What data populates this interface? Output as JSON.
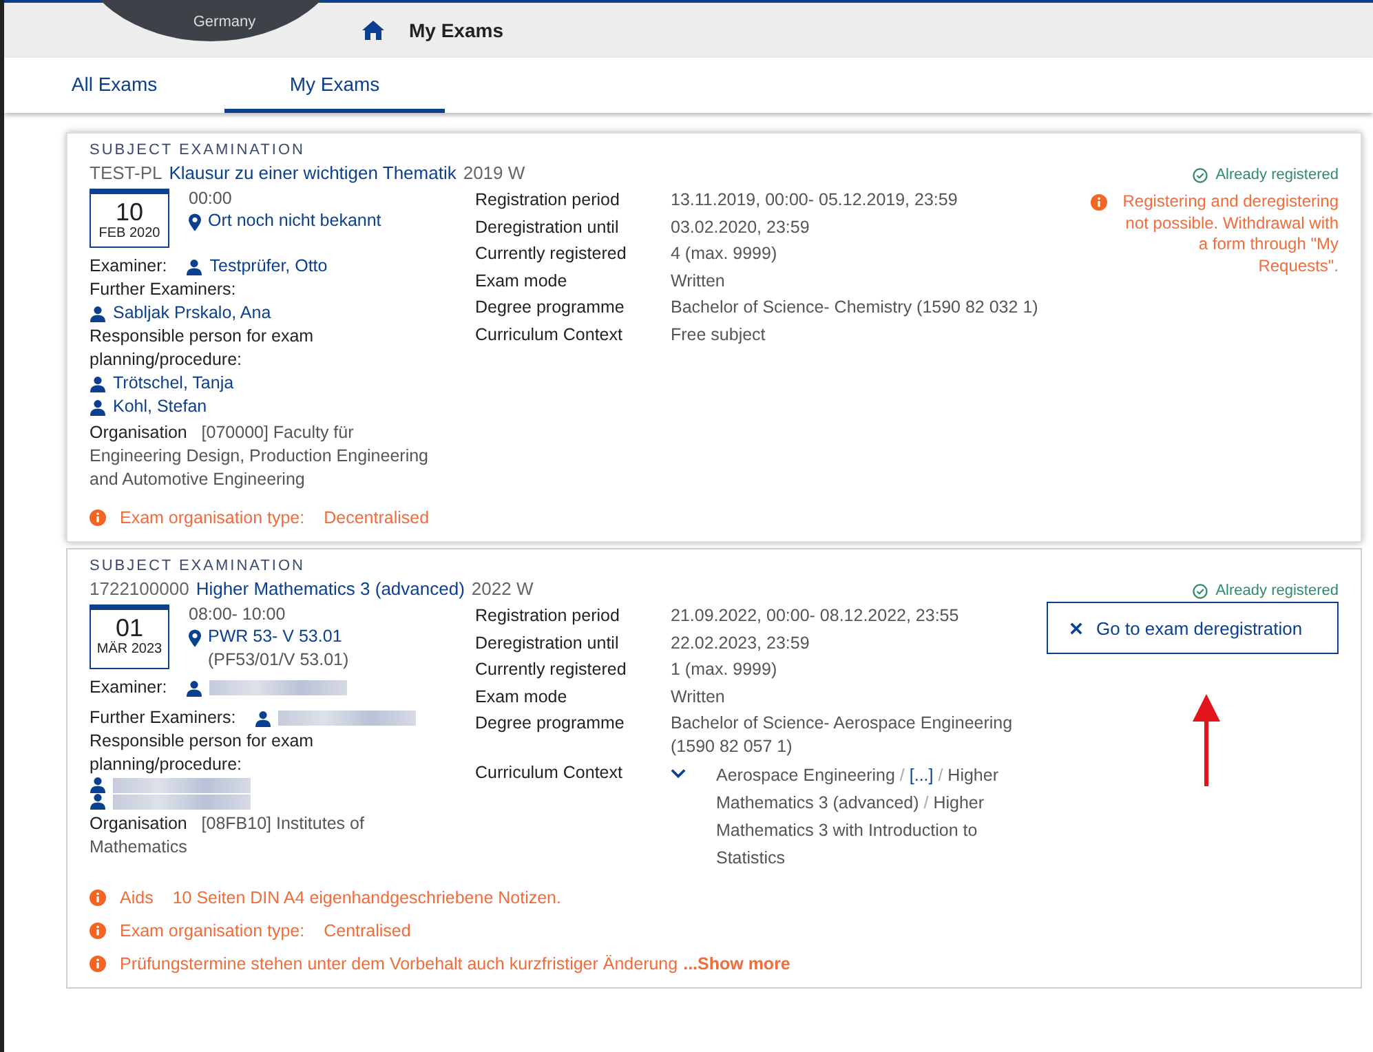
{
  "header": {
    "logo_text": "Germany",
    "breadcrumb": "My Exams"
  },
  "tabs": [
    {
      "label": "All Exams",
      "selected": false
    },
    {
      "label": "My Exams",
      "selected": true
    }
  ],
  "exams": [
    {
      "type_label": "SUBJECT EXAMINATION",
      "code": "TEST-PL",
      "title": "Klausur zu einer wichtigen Thematik",
      "term": "2019 W",
      "date": {
        "day": "10",
        "month_year": "FEB 2020"
      },
      "time": "00:00",
      "location": [
        "Ort noch nicht bekannt"
      ],
      "examiner": {
        "label": "Examiner:",
        "people": [
          {
            "kind": "name",
            "name": "Testprüfer, Otto"
          }
        ]
      },
      "further": {
        "label": "Further Examiners:",
        "inline": false,
        "people": [
          {
            "kind": "name",
            "name": "Sabljak Prskalo, Ana"
          }
        ]
      },
      "responsible": {
        "label": "Responsible person for exam planning/procedure:",
        "people": [
          {
            "kind": "name",
            "name": "Trötschel, Tanja"
          },
          {
            "kind": "name",
            "name": "Kohl, Stefan"
          }
        ]
      },
      "organisation": {
        "label": "Organisation",
        "value": "[070000] Faculty für Engineering Design, Production Engineering and Automotive Engineering"
      },
      "details": [
        {
          "label": "Registration period",
          "kind": "text",
          "value": "13.11.2019, 00:00- 05.12.2019, 23:59"
        },
        {
          "label": "Deregistration until",
          "kind": "text",
          "value": "03.02.2020, 23:59"
        },
        {
          "label": "Currently registered",
          "kind": "text",
          "value": "4 (max. 9999)"
        },
        {
          "label": "Exam mode",
          "kind": "text",
          "value": "Written"
        },
        {
          "label": "Degree programme",
          "kind": "text",
          "value": "Bachelor of Science- Chemistry (1590 82 032 1)"
        },
        {
          "label": "Curriculum Context",
          "kind": "text",
          "value": "Free subject"
        }
      ],
      "status": "Already registered",
      "warning": "Registering and deregistering not possible. Withdrawal with a form through \"My Requests\".",
      "notices": [
        {
          "label": "Exam organisation type:",
          "value": "Decentralised"
        }
      ]
    },
    {
      "type_label": "SUBJECT EXAMINATION",
      "code": "1722100000",
      "title": "Higher Mathematics 3 (advanced)",
      "term": "2022 W",
      "date": {
        "day": "01",
        "month_year": "MÄR 2023"
      },
      "time": "08:00- 10:00",
      "location": [
        "PWR 53- V 53.01",
        "(PF53/01/V 53.01)"
      ],
      "examiner": {
        "label": "Examiner:",
        "people": [
          {
            "kind": "redacted"
          }
        ]
      },
      "further": {
        "label": "Further Examiners:",
        "inline": true,
        "people": [
          {
            "kind": "redacted"
          }
        ]
      },
      "responsible": {
        "label": "Responsible person for exam planning/procedure:",
        "people": [
          {
            "kind": "redacted"
          },
          {
            "kind": "redacted"
          }
        ]
      },
      "organisation": {
        "label": "Organisation",
        "value": "[08FB10] Institutes of Mathematics"
      },
      "details": [
        {
          "label": "Registration period",
          "kind": "text",
          "value": "21.09.2022, 00:00- 08.12.2022, 23:55"
        },
        {
          "label": "Deregistration until",
          "kind": "text",
          "value": "22.02.2023, 23:59"
        },
        {
          "label": "Currently registered",
          "kind": "text",
          "value": "1 (max. 9999)"
        },
        {
          "label": "Exam mode",
          "kind": "text",
          "value": "Written"
        },
        {
          "label": "Degree programme",
          "kind": "text",
          "value": "Bachelor of Science- Aerospace Engineering (1590 82 057 1)"
        },
        {
          "label": "Curriculum Context",
          "kind": "path",
          "expanded": true,
          "separator": "/",
          "path": [
            "Aerospace Engineering",
            "[...]",
            "Higher Mathematics 3 (advanced)",
            "Higher Mathematics 3 with Introduction to Statistics"
          ]
        }
      ],
      "status": "Already registered",
      "button": "Go to exam deregistration",
      "annotated": true,
      "notices": [
        {
          "label": "Aids",
          "value": "10 Seiten DIN A4 eigenhandgeschriebene Notizen."
        },
        {
          "label": "Exam organisation type:",
          "value": "Centralised"
        },
        {
          "text": "Prüfungstermine stehen unter dem Vorbehalt auch kurzfristiger Änderung",
          "link": "...Show more"
        }
      ]
    }
  ]
}
